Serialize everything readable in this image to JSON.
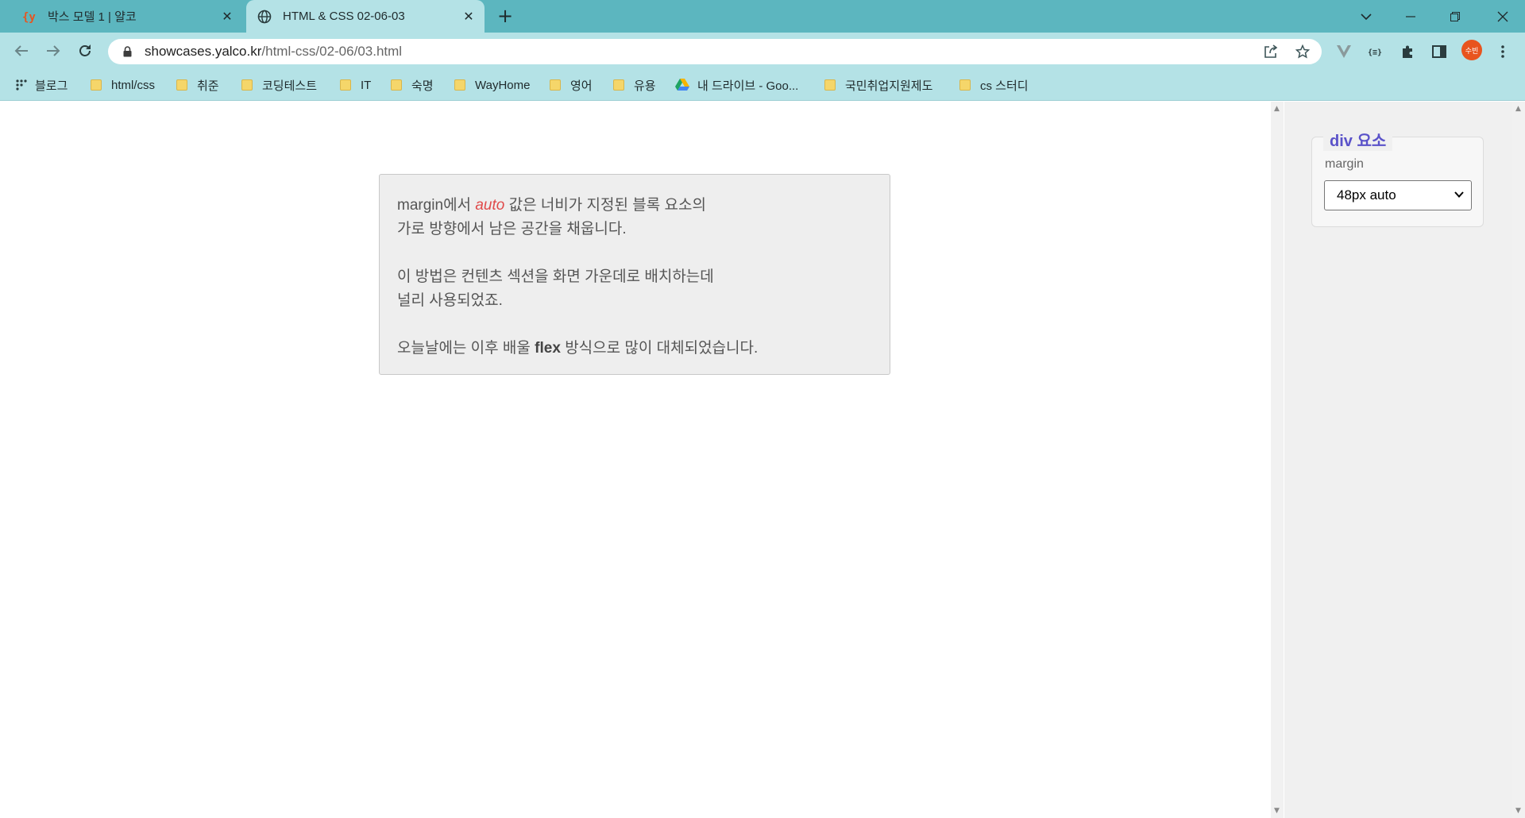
{
  "browser": {
    "tabs": [
      {
        "title": "박스 모델 1 | 얄코",
        "active": false
      },
      {
        "title": "HTML & CSS 02-06-03",
        "active": true
      }
    ],
    "url_host": "showcases.yalco.kr",
    "url_path": "/html-css/02-06/03.html",
    "profile_label": "수빈",
    "colors": {
      "frame": "#5cb6bf",
      "toolbar": "#b4e2e6",
      "profile": "#e8541e"
    }
  },
  "bookmarks": [
    {
      "label": "블로그",
      "icon": "apps-grid-icon"
    },
    {
      "label": "html/css",
      "icon": "folder-icon"
    },
    {
      "label": "취준",
      "icon": "folder-icon"
    },
    {
      "label": "코딩테스트",
      "icon": "folder-icon"
    },
    {
      "label": "IT",
      "icon": "folder-icon"
    },
    {
      "label": "숙명",
      "icon": "folder-icon"
    },
    {
      "label": "WayHome",
      "icon": "folder-icon"
    },
    {
      "label": "영어",
      "icon": "folder-icon"
    },
    {
      "label": "유용",
      "icon": "folder-icon"
    },
    {
      "label": "내 드라이브 - Goo...",
      "icon": "google-drive-icon"
    },
    {
      "label": "국민취업지원제도",
      "icon": "folder-icon"
    },
    {
      "label": "cs 스터디",
      "icon": "folder-icon"
    }
  ],
  "content": {
    "p1_before": "margin에서 ",
    "p1_em": "auto",
    "p1_after": " 값은 너비가 지정된 블록 요소의",
    "p1_line2": "가로 방향에서 남은 공간을 채웁니다.",
    "p2_line1": "이 방법은 컨텐츠 섹션을 화면 가운데로 배치하는데",
    "p2_line2": "널리 사용되었죠.",
    "p3_before": "오늘날에는 이후 배울 ",
    "p3_strong": "flex",
    "p3_after": " 방식으로 많이 대체되었습니다.",
    "em_color": "#e04a4a"
  },
  "panel": {
    "legend": "div 요소",
    "property_label": "margin",
    "select_value": "48px auto",
    "legend_color": "#5a52c9"
  }
}
